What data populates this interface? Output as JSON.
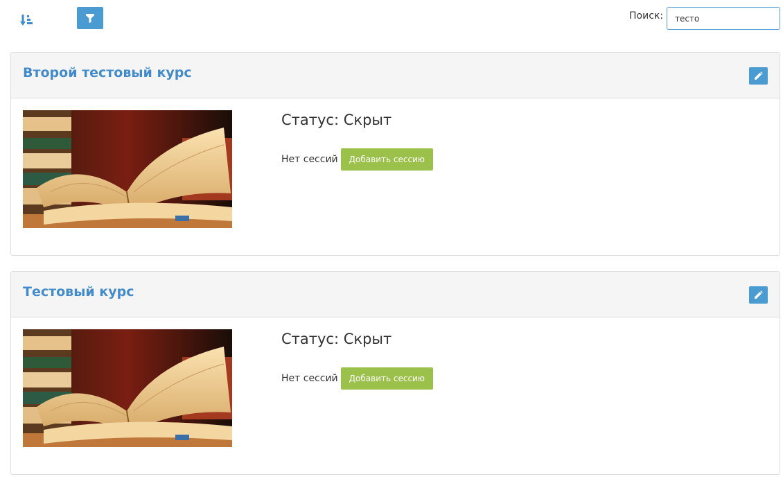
{
  "toolbar": {
    "sort_icon": "sort-amount-icon",
    "filter_icon": "filter-icon",
    "search_label": "Поиск:",
    "search_value": "тесто"
  },
  "courses": [
    {
      "title": "Второй тестовый курс",
      "status": "Статус: Скрыт",
      "sessions_text": "Нет сессий",
      "add_session_label": "Добавить сессию",
      "image": "open-book-thumbnail"
    },
    {
      "title": "Тестовый курс",
      "status": "Статус: Скрыт",
      "sessions_text": "Нет сессий",
      "add_session_label": "Добавить сессию",
      "image": "open-book-thumbnail"
    }
  ],
  "colors": {
    "accent": "#4a9bd1",
    "title": "#428bca",
    "success": "#9cc14a",
    "header_bg": "#f5f5f5"
  }
}
